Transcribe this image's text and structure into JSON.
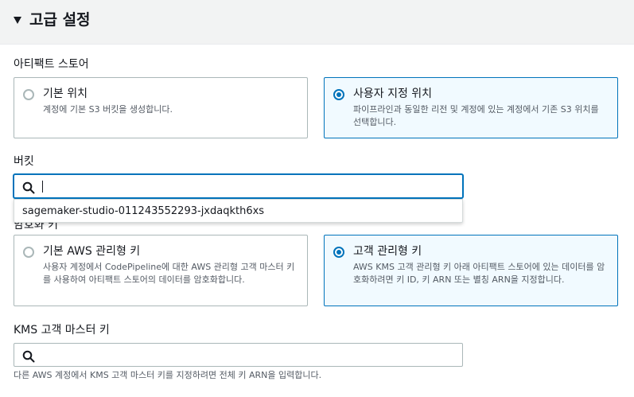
{
  "section": {
    "title": "고급 설정"
  },
  "artifact_store": {
    "label": "아티팩트 스토어",
    "options": [
      {
        "title": "기본 위치",
        "description": "계정에 기본 S3 버킷을 생성합니다.",
        "selected": false
      },
      {
        "title": "사용자 지정 위치",
        "description": "파이프라인과 동일한 리전 및 계정에 있는 계정에서 기존 S3 위치를 선택합니다.",
        "selected": true
      }
    ]
  },
  "bucket": {
    "label": "버킷",
    "value": "",
    "suggestion": "sagemaker-studio-011243552293-jxdaqkth6xs"
  },
  "encryption": {
    "label": "암호화 키",
    "options": [
      {
        "title": "기본 AWS 관리형 키",
        "description": "사용자 계정에서 CodePipeline에 대한 AWS 관리형 고객 마스터 키를 사용하여 아티팩트 스토어의 데이터를 암호화합니다.",
        "selected": false
      },
      {
        "title": "고객 관리형 키",
        "description": "AWS KMS 고객 관리형 키 아래 아티팩트 스토어에 있는 데이터를 암호화하려면 키 ID, 키 ARN 또는 별칭 ARN을 지정합니다.",
        "selected": true
      }
    ]
  },
  "kms_key": {
    "label": "KMS 고객 마스터 키",
    "value": "",
    "hint": "다른 AWS 계정에서 KMS 고객 마스터 키를 지정하려면 전체 키 ARN을 입력합니다."
  },
  "colors": {
    "accent": "#0073bb",
    "selected_bg": "#f1faff",
    "border": "#aab7b8",
    "header_bg": "#f2f3f3"
  }
}
